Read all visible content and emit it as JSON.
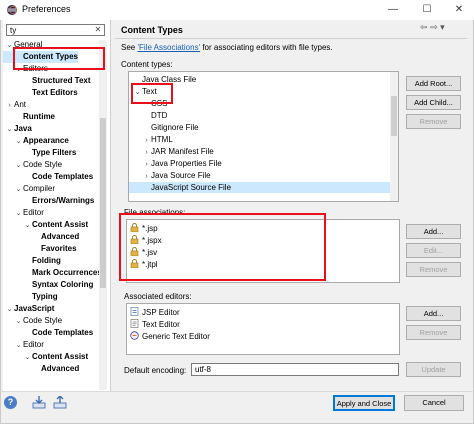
{
  "window": {
    "title": "Preferences",
    "min_glyph": "—",
    "max_glyph": "☐",
    "close_glyph": "✕"
  },
  "left": {
    "filter_value": "ty",
    "filter_clear": "✕",
    "tree": [
      {
        "label": "General",
        "depth": 1,
        "twisty": "⌄",
        "bold": false
      },
      {
        "label": "Content Types",
        "depth": 2,
        "twisty": "",
        "bold": true,
        "selected": true
      },
      {
        "label": "Editors",
        "depth": 2,
        "twisty": "⌄",
        "bold": false
      },
      {
        "label": "Structured Text",
        "depth": 3,
        "twisty": "",
        "bold": true
      },
      {
        "label": "Text Editors",
        "depth": 3,
        "twisty": "",
        "bold": true
      },
      {
        "label": "Ant",
        "depth": 1,
        "twisty": "›",
        "bold": false
      },
      {
        "label": "Runtime",
        "depth": 2,
        "twisty": "",
        "bold": true
      },
      {
        "label": "Java",
        "depth": 1,
        "twisty": "⌄",
        "bold": true
      },
      {
        "label": "Appearance",
        "depth": 2,
        "twisty": "⌄",
        "bold": true
      },
      {
        "label": "Type Filters",
        "depth": 3,
        "twisty": "",
        "bold": true
      },
      {
        "label": "Code Style",
        "depth": 2,
        "twisty": "⌄",
        "bold": false
      },
      {
        "label": "Code Templates",
        "depth": 3,
        "twisty": "",
        "bold": true
      },
      {
        "label": "Compiler",
        "depth": 2,
        "twisty": "⌄",
        "bold": false
      },
      {
        "label": "Errors/Warnings",
        "depth": 3,
        "twisty": "",
        "bold": true
      },
      {
        "label": "Editor",
        "depth": 2,
        "twisty": "⌄",
        "bold": false
      },
      {
        "label": "Content Assist",
        "depth": 3,
        "twisty": "⌄",
        "bold": true
      },
      {
        "label": "Advanced",
        "depth": 4,
        "twisty": "",
        "bold": true
      },
      {
        "label": "Favorites",
        "depth": 4,
        "twisty": "",
        "bold": true
      },
      {
        "label": "Folding",
        "depth": 3,
        "twisty": "",
        "bold": true
      },
      {
        "label": "Mark Occurrences",
        "depth": 3,
        "twisty": "",
        "bold": true
      },
      {
        "label": "Syntax Coloring",
        "depth": 3,
        "twisty": "",
        "bold": true
      },
      {
        "label": "Typing",
        "depth": 3,
        "twisty": "",
        "bold": true
      },
      {
        "label": "JavaScript",
        "depth": 1,
        "twisty": "⌄",
        "bold": true
      },
      {
        "label": "Code Style",
        "depth": 2,
        "twisty": "⌄",
        "bold": false
      },
      {
        "label": "Code Templates",
        "depth": 3,
        "twisty": "",
        "bold": true
      },
      {
        "label": "Editor",
        "depth": 2,
        "twisty": "⌄",
        "bold": false
      },
      {
        "label": "Content Assist",
        "depth": 3,
        "twisty": "⌄",
        "bold": true
      },
      {
        "label": "Advanced",
        "depth": 4,
        "twisty": "",
        "bold": true
      }
    ]
  },
  "page": {
    "title": "Content Types",
    "nav_back": "⇦",
    "nav_forward": "⇨",
    "nav_menu": "▾",
    "see_prefix": "See ",
    "see_link": "'File Associations'",
    "see_suffix": " for associating editors with file types.",
    "content_types_label": "Content types:",
    "content_types": [
      {
        "label": "Java Class File",
        "depth": 0,
        "twisty": ""
      },
      {
        "label": "Text",
        "depth": 0,
        "twisty": "⌄"
      },
      {
        "label": "CSS",
        "depth": 1,
        "twisty": ""
      },
      {
        "label": "DTD",
        "depth": 1,
        "twisty": ""
      },
      {
        "label": "Gitignore File",
        "depth": 1,
        "twisty": ""
      },
      {
        "label": "HTML",
        "depth": 1,
        "twisty": "›"
      },
      {
        "label": "JAR Manifest File",
        "depth": 1,
        "twisty": "›"
      },
      {
        "label": "Java Properties File",
        "depth": 1,
        "twisty": "›"
      },
      {
        "label": "Java Source File",
        "depth": 1,
        "twisty": "›"
      },
      {
        "label": "JavaScript Source File",
        "depth": 1,
        "twisty": "",
        "selected": true
      }
    ],
    "ct_buttons": {
      "add_root": "Add Root...",
      "add_child": "Add Child...",
      "remove": "Remove"
    },
    "file_assoc_label": "File associations:",
    "file_assoc": [
      "*.jsp",
      "*.jspx",
      "*.jsv",
      "*.jtpl"
    ],
    "fa_buttons": {
      "add": "Add...",
      "edit": "Edit...",
      "remove": "Remove"
    },
    "editors_label": "Associated editors:",
    "editors": [
      "JSP Editor",
      "Text Editor",
      "Generic Text Editor"
    ],
    "ed_buttons": {
      "add": "Add...",
      "remove": "Remove"
    },
    "encoding_label": "Default encoding:",
    "encoding_value": "utf-8",
    "update_button": "Update"
  },
  "footer": {
    "help_glyph": "?",
    "apply_close": "Apply and Close",
    "cancel": "Cancel"
  },
  "colors": {
    "highlight": "#e8101a",
    "selection": "#cce8ff",
    "link": "#1a5fb4"
  }
}
